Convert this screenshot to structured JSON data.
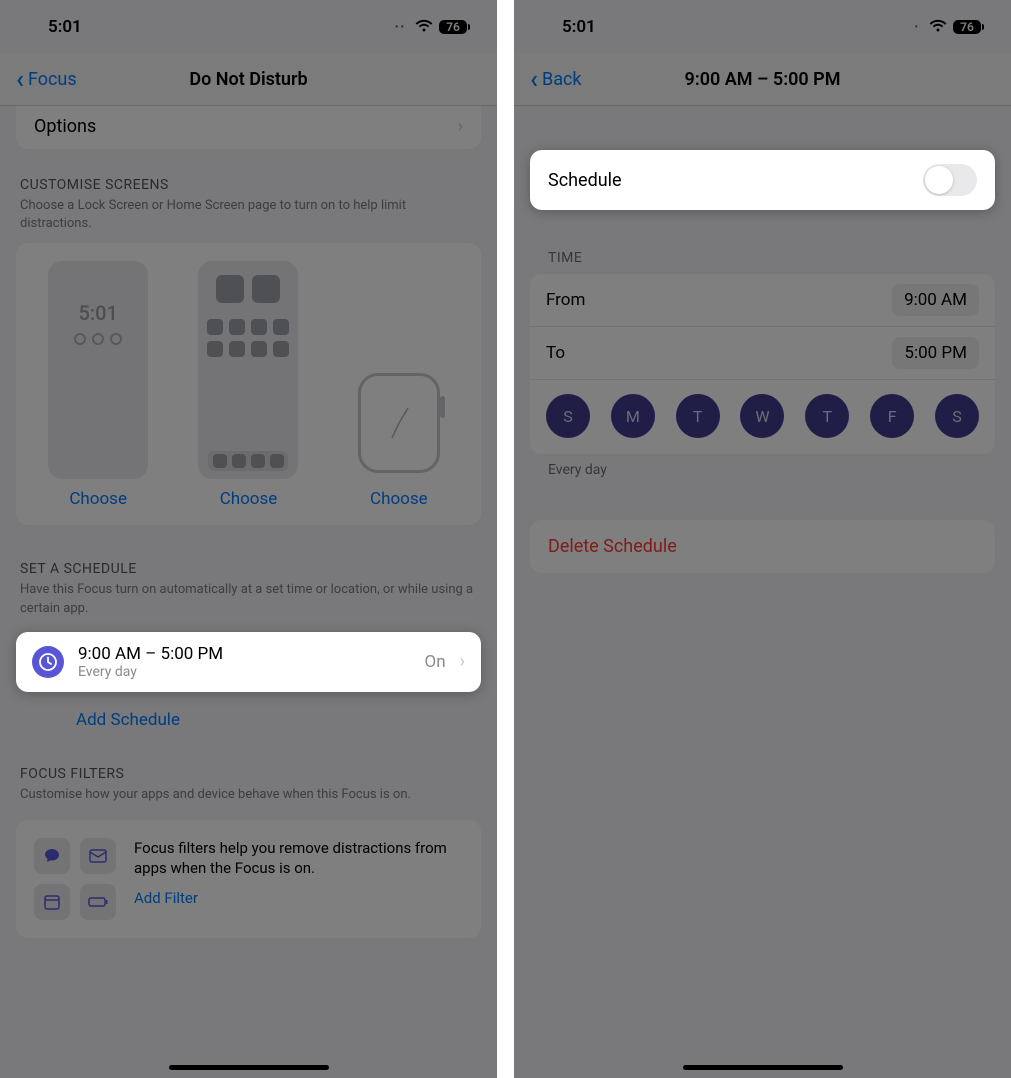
{
  "screen1": {
    "status": {
      "time": "5:01",
      "battery": "76"
    },
    "nav": {
      "back_label": "Focus",
      "title": "Do Not Disturb"
    },
    "options_label": "Options",
    "customise": {
      "header": "CUSTOMISE SCREENS",
      "sub": "Choose a Lock Screen or Home Screen page to turn on to help limit distractions.",
      "lock_time": "5:01",
      "choose_label": "Choose"
    },
    "schedule": {
      "header": "SET A SCHEDULE",
      "sub": "Have this Focus turn on automatically at a set time or location, or while using a certain app.",
      "row_title": "9:00 AM – 5:00 PM",
      "row_sub": "Every day",
      "row_state": "On",
      "add_label": "Add Schedule"
    },
    "filters": {
      "header": "FOCUS FILTERS",
      "sub": "Customise how your apps and device behave when this Focus is on.",
      "desc": "Focus filters help you remove distractions from apps when the Focus is on.",
      "add_label": "Add Filter"
    }
  },
  "screen2": {
    "status": {
      "time": "5:01",
      "battery": "76"
    },
    "nav": {
      "back_label": "Back",
      "title": "9:00 AM – 5:00 PM"
    },
    "toggle_label": "Schedule",
    "toggle_on": false,
    "time": {
      "header": "TIME",
      "from_label": "From",
      "from_value": "9:00 AM",
      "to_label": "To",
      "to_value": "5:00 PM",
      "days": [
        "S",
        "M",
        "T",
        "W",
        "T",
        "F",
        "S"
      ],
      "every_day_label": "Every day"
    },
    "delete_label": "Delete Schedule"
  }
}
